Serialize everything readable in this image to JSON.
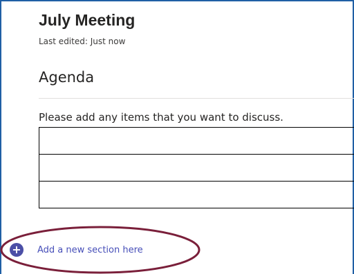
{
  "page": {
    "title": "July Meeting",
    "last_edited": "Last edited: Just now"
  },
  "section": {
    "heading": "Agenda",
    "prompt": "Please add any items that you want to discuss.",
    "table_rows": [
      "",
      "",
      ""
    ]
  },
  "add_section": {
    "label": "Add a new section here",
    "icon": "plus-circle-icon"
  },
  "colors": {
    "accent": "#464eb8",
    "frame_border": "#1f5fa5",
    "annotation": "#7a1f3a"
  }
}
